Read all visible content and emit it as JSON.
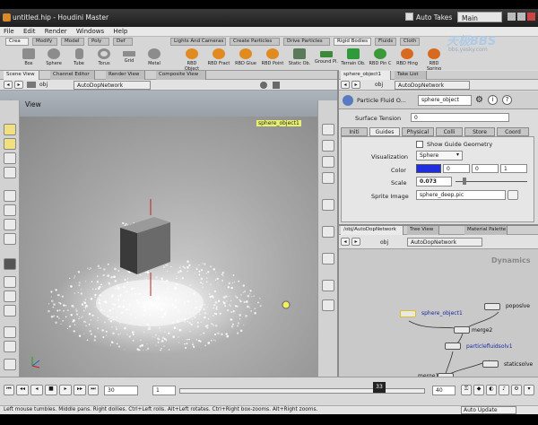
{
  "window": {
    "title": "untitled.hip - Houdini Master",
    "auto_takes": "Auto Takes",
    "desktop": "Main"
  },
  "watermark": {
    "text": "天极BBS",
    "sub": "bbs.yesky.com"
  },
  "menu": [
    "File",
    "Edit",
    "Render",
    "Windows",
    "Help"
  ],
  "shelf": {
    "left_tabs": [
      "Crea",
      "Modify",
      "Model",
      "Poly",
      "Def"
    ],
    "right_tabs": [
      "Lights And Cameras",
      "Create Particles",
      "Drive Particles",
      "Rigid Bodies",
      "Fluids",
      "Cloth"
    ],
    "left_tools": [
      {
        "label": "Box",
        "color": "#8c8c8c"
      },
      {
        "label": "Sphere",
        "color": "#8c8c8c"
      },
      {
        "label": "Tube",
        "color": "#8c8c8c"
      },
      {
        "label": "Torus",
        "color": "#8c8c8c"
      },
      {
        "label": "Grid",
        "color": "#8c8c8c"
      },
      {
        "label": "Metal",
        "color": "#8c8c8c"
      }
    ],
    "right_tools": [
      {
        "label": "RBD Object",
        "color": "#e08a20"
      },
      {
        "label": "RBD Fract",
        "color": "#e08a20"
      },
      {
        "label": "RBD Glue",
        "color": "#e08a20"
      },
      {
        "label": "RBD Point",
        "color": "#e08a20"
      },
      {
        "label": "Static Ob.",
        "color": "#4a8a4a"
      },
      {
        "label": "Ground Pl.",
        "color": "#4a8a4a"
      },
      {
        "label": "Terrain Ob.",
        "color": "#4a8a4a"
      },
      {
        "label": "RBD Pin C",
        "color": "#3a9a3a"
      },
      {
        "label": "RBD Hing",
        "color": "#d86a20"
      },
      {
        "label": "RBD Spring",
        "color": "#d86a20"
      }
    ]
  },
  "scene_pane": {
    "tabs": [
      "Scene View",
      "Channel Editor",
      "Render View",
      "Composite View"
    ],
    "path": "obj",
    "network": "AutoDopNetwork",
    "view_label": "View",
    "viewport_label": "sphere_object1",
    "status": "Left mouse tumbles. Middle pans. Right dollies. Ctrl+Left rolls. Alt+Left rotates. Ctrl+Right box-zooms. Alt+Right zooms."
  },
  "param_pane": {
    "tabs": [
      "sphere_object1",
      "Take List"
    ],
    "path": "obj",
    "network": "AutoDopNetwork",
    "node_type": "Particle Fluid O...",
    "node_name": "sphere_object",
    "surface_tension_label": "Surface Tension",
    "surface_tension_value": "0",
    "subtabs": [
      "Initi",
      "Guides",
      "Physical",
      "Colli",
      "Store",
      "Coord"
    ],
    "show_guide": "Show Guide Geometry",
    "visualization_label": "Visualization",
    "visualization_value": "Sphere",
    "color_label": "Color",
    "color_swatch": "#1f2fe0",
    "color_values": [
      "0",
      "0",
      "1"
    ],
    "scale_label": "Scale",
    "scale_value": "0.073",
    "sprite_label": "Sprite Image",
    "sprite_value": "sphere_deep.pic"
  },
  "net_pane": {
    "tabs": [
      "/obj/AutoDopNetwork",
      "Tree View",
      "Material Palette"
    ],
    "path": "obj",
    "network": "AutoDopNetwork",
    "context_label": "Dynamics",
    "nodes": [
      "sphere_object1",
      "poposlve",
      "merge2",
      "particlefluidsolv1",
      "staticsolve",
      "merge1"
    ]
  },
  "timeline": {
    "current_frame": "30",
    "start_frame": "1",
    "marker": "33",
    "end_frame": "40",
    "auto_update": "Auto Update"
  }
}
